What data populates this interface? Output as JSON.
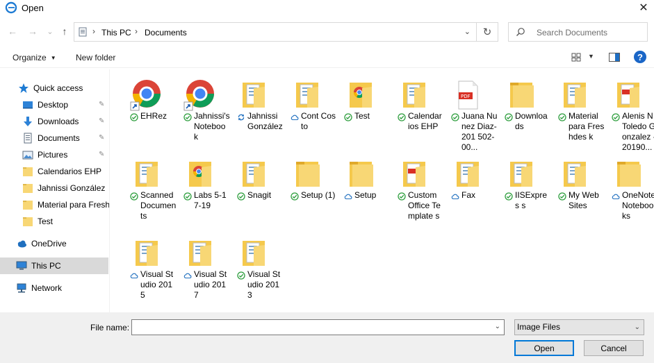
{
  "window": {
    "title": "Open",
    "close_glyph": "✕"
  },
  "nav": {
    "back_glyph": "←",
    "forward_glyph": "→",
    "recent_glyph": "⌄",
    "up_glyph": "↑",
    "breadcrumbs": [
      "This PC",
      "Documents"
    ],
    "separator": "›",
    "refresh_glyph": "↻",
    "search_placeholder": "Search Documents"
  },
  "toolbar": {
    "organize_label": "Organize",
    "organize_caret": "▼",
    "new_folder_label": "New folder",
    "view_caret": "▼",
    "help_label": "?"
  },
  "sidebar": {
    "items": [
      {
        "label": "Quick access",
        "icon": "star-icon"
      },
      {
        "label": "Desktop",
        "icon": "desktop-icon",
        "pinned": true
      },
      {
        "label": "Downloads",
        "icon": "download-icon",
        "pinned": true
      },
      {
        "label": "Documents",
        "icon": "documents-icon",
        "pinned": true
      },
      {
        "label": "Pictures",
        "icon": "pictures-icon",
        "pinned": true
      },
      {
        "label": "Calendarios EHP",
        "icon": "folder-icon"
      },
      {
        "label": "Jahnissi González",
        "icon": "folder-icon"
      },
      {
        "label": "Material para Freshdesk",
        "icon": "folder-icon"
      },
      {
        "label": "Test",
        "icon": "folder-icon"
      },
      {
        "label": "OneDrive",
        "icon": "cloud-icon"
      },
      {
        "label": "This PC",
        "icon": "pc-icon",
        "selected": true
      },
      {
        "label": "Network",
        "icon": "network-icon"
      }
    ],
    "pin_glyph": "📌"
  },
  "files": [
    {
      "name": "EHRez",
      "kind": "chrome-shortcut",
      "status": "synced"
    },
    {
      "name": "Jahnissi's Noteboo k",
      "kind": "chrome-shortcut",
      "status": "synced"
    },
    {
      "name": "Jahnissi González",
      "kind": "folder-docs",
      "status": "syncing"
    },
    {
      "name": "Cont Costo",
      "kind": "folder-docs",
      "status": "cloud"
    },
    {
      "name": "Test",
      "kind": "folder-chrome",
      "status": "synced"
    },
    {
      "name": "Calendar ios EHP",
      "kind": "folder-docs",
      "status": "synced"
    },
    {
      "name": "Juana Nunez Diaz-201 502-00...",
      "kind": "pdf",
      "status": "synced"
    },
    {
      "name": "Downloa ds",
      "kind": "folder",
      "status": "synced"
    },
    {
      "name": "Material para Freshdes k",
      "kind": "folder-docs",
      "status": "synced"
    },
    {
      "name": "Alenis N Toledo Gonzalez -20190...",
      "kind": "folder-pdf",
      "status": "synced"
    },
    {
      "name": "Scanned Documents",
      "kind": "folder-docs",
      "status": "synced"
    },
    {
      "name": "Labs 5-17-19",
      "kind": "folder-chrome",
      "status": "synced"
    },
    {
      "name": "Snagit",
      "kind": "folder-docs",
      "status": "synced"
    },
    {
      "name": "Setup (1)",
      "kind": "folder",
      "status": "synced"
    },
    {
      "name": "Setup",
      "kind": "folder",
      "status": "cloud"
    },
    {
      "name": "Custom Office Template s",
      "kind": "folder-pdf",
      "status": "synced"
    },
    {
      "name": "Fax",
      "kind": "folder-docs",
      "status": "cloud"
    },
    {
      "name": "IISExpres s",
      "kind": "folder-docs",
      "status": "synced"
    },
    {
      "name": "My Web Sites",
      "kind": "folder-docs",
      "status": "synced"
    },
    {
      "name": "OneNote Noteboo ks",
      "kind": "folder",
      "status": "cloud"
    },
    {
      "name": "Visual Studio 2015",
      "kind": "folder-docs",
      "status": "cloud"
    },
    {
      "name": "Visual Studio 2017",
      "kind": "folder-docs",
      "status": "cloud"
    },
    {
      "name": "Visual Studio 2013",
      "kind": "folder-docs",
      "status": "synced"
    }
  ],
  "footer": {
    "file_name_label": "File name:",
    "file_name_value": "",
    "file_type_value": "Image Files",
    "drop_glyph": "⌄",
    "open_label": "Open",
    "cancel_label": "Cancel"
  },
  "colors": {
    "accent": "#0078d7",
    "folder": "#f8d775",
    "sync_green": "#2e9e3e",
    "cloud_blue": "#1f6fbf",
    "pdf_red": "#d93025"
  }
}
